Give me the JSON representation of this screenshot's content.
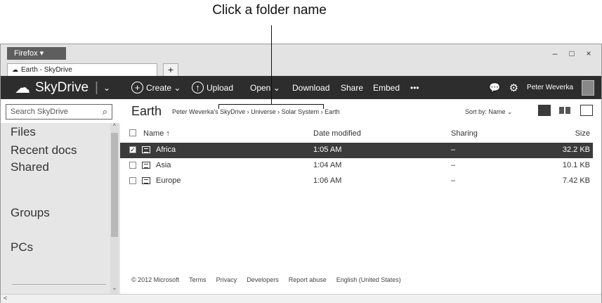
{
  "callout": {
    "text": "Click a folder name"
  },
  "browser": {
    "firefox_label": "Firefox",
    "tab_title": "Earth - SkyDrive",
    "new_tab": "+",
    "window_controls": [
      "–",
      "□",
      "×"
    ]
  },
  "appbar": {
    "brand": "SkyDrive",
    "brand_sep": "|",
    "brand_chevron": "⌄",
    "commands": {
      "create": "Create",
      "upload": "Upload",
      "open": "Open",
      "download": "Download",
      "share": "Share",
      "embed": "Embed",
      "more": "•••"
    },
    "user_name": "Peter Weverka"
  },
  "toolbar": {
    "search_placeholder": "Search SkyDrive",
    "folder_title": "Earth",
    "breadcrumb": "Peter Weverka's SkyDrive › Universe › Solar System › Earth",
    "sort_label": "Sort by: Name ⌄"
  },
  "nav": {
    "items": [
      "Files",
      "Recent docs",
      "Shared",
      "Groups",
      "PCs"
    ]
  },
  "table": {
    "headers": {
      "name": "Name ↑",
      "date": "Date modified",
      "sharing": "Sharing",
      "size": "Size"
    },
    "rows": [
      {
        "name": "Africa",
        "date": "1:05 AM",
        "sharing": "–",
        "size": "32.2 KB",
        "selected": true
      },
      {
        "name": "Asia",
        "date": "1:04 AM",
        "sharing": "–",
        "size": "10.1 KB",
        "selected": false
      },
      {
        "name": "Europe",
        "date": "1:06 AM",
        "sharing": "–",
        "size": "7.42 KB",
        "selected": false
      }
    ]
  },
  "footer": {
    "copyright": "© 2012 Microsoft",
    "links": [
      "Terms",
      "Privacy",
      "Developers",
      "Report abuse",
      "English (United States)"
    ]
  },
  "colors": {
    "appbar": "#2d2d2d",
    "selected_row": "#3b3b3b",
    "nav_bg": "#e6e6e6"
  },
  "icons": [
    "cloud-icon",
    "plus-circle-icon",
    "upload-circle-icon",
    "chat-icon",
    "gear-icon",
    "search-icon",
    "list-view-icon",
    "thumbnail-view-icon",
    "details-pane-icon",
    "folder-icon"
  ]
}
